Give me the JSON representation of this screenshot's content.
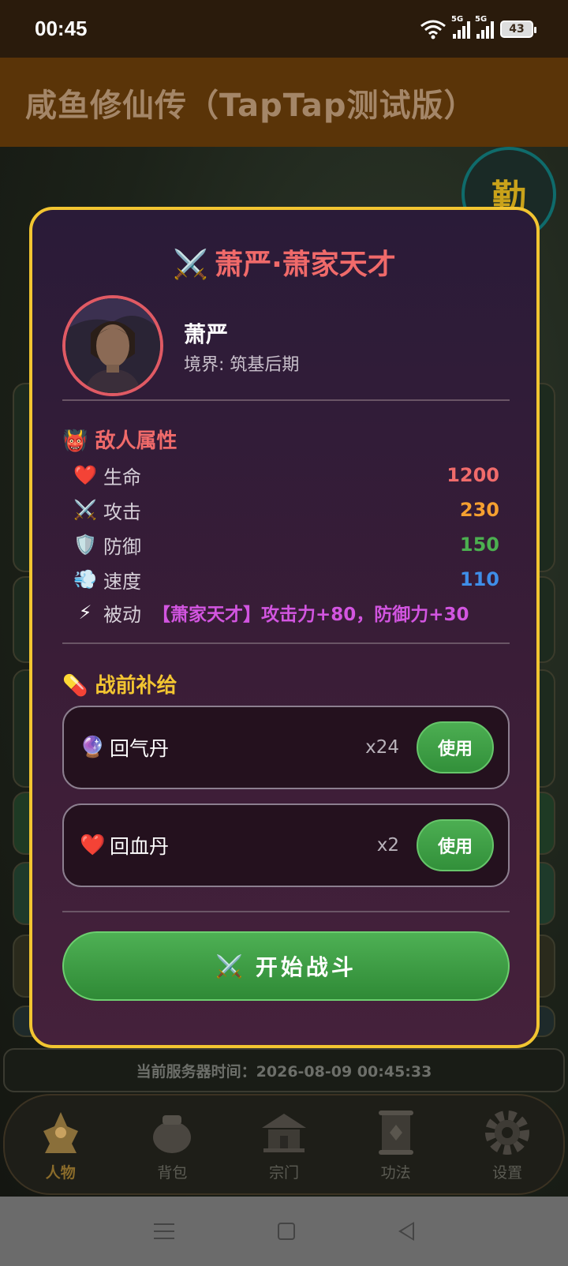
{
  "status_bar": {
    "time": "00:45",
    "network1": "5G",
    "network2": "5G",
    "battery": "43"
  },
  "app": {
    "title": "咸鱼修仙传（TapTap测试版）",
    "qin_badge": "勤"
  },
  "modal": {
    "title": "萧严·萧家天才",
    "title_icon": "crossed-swords-icon",
    "enemy": {
      "name": "萧严",
      "realm_label": "境界: ",
      "realm_value": "筑基后期"
    },
    "enemy_section": {
      "title": "敌人属性",
      "icon": "oni-mask-icon",
      "stats": [
        {
          "icon": "❤️",
          "label": "生命",
          "value": "1200",
          "color": "#f06b6b"
        },
        {
          "icon": "⚔️",
          "label": "攻击",
          "value": "230",
          "color": "#f5a030"
        },
        {
          "icon": "🛡️",
          "label": "防御",
          "value": "150",
          "color": "#4caf50"
        },
        {
          "icon": "💨",
          "label": "速度",
          "value": "110",
          "color": "#3f8ee8"
        }
      ],
      "passive": {
        "icon": "⚡",
        "label": "被动",
        "text": "【萧家天才】攻击力+80，防御力+30",
        "color": "#d255e0"
      }
    },
    "supply_section": {
      "title": "战前补给",
      "icon": "pill-icon",
      "items": [
        {
          "icon": "🔮",
          "name": "回气丹",
          "count": "x24",
          "button": "使用"
        },
        {
          "icon": "❤️",
          "name": "回血丹",
          "count": "x2",
          "button": "使用"
        }
      ]
    },
    "start_button": {
      "icon": "⚔️",
      "label": "开始战斗"
    }
  },
  "server_time": "当前服务器时间：2026-08-09 00:45:33",
  "bottom_nav": {
    "items": [
      {
        "label": "人物",
        "icon": "character-icon",
        "active": true
      },
      {
        "label": "背包",
        "icon": "bag-icon",
        "active": false
      },
      {
        "label": "宗门",
        "icon": "sect-icon",
        "active": false
      },
      {
        "label": "功法",
        "icon": "scroll-icon",
        "active": false
      },
      {
        "label": "设置",
        "icon": "gear-icon",
        "active": false
      }
    ]
  },
  "colors": {
    "modal_border": "#f2c531",
    "title_red": "#f06a6a",
    "supply_gold": "#f2c531",
    "button_green": "#3ea345"
  }
}
